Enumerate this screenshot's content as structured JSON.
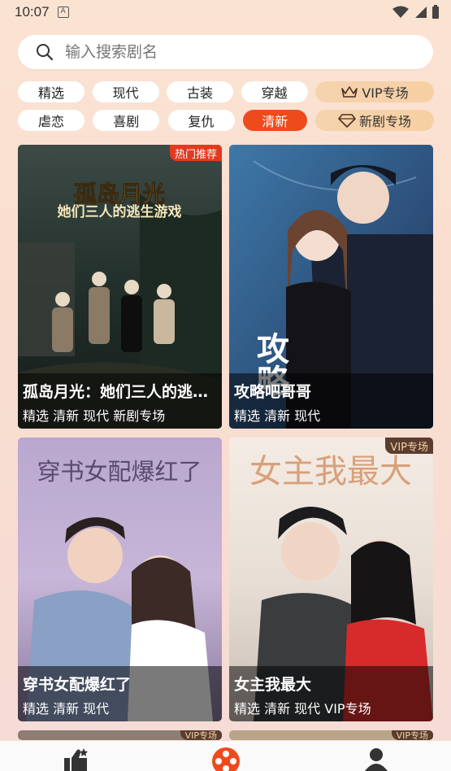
{
  "status": {
    "time": "10:07"
  },
  "search": {
    "placeholder": "输入搜索剧名"
  },
  "chips": [
    {
      "label": "精选"
    },
    {
      "label": "现代"
    },
    {
      "label": "古装"
    },
    {
      "label": "穿越"
    },
    {
      "label": "VIP专场"
    },
    {
      "label": "虐恋"
    },
    {
      "label": "喜剧"
    },
    {
      "label": "复仇"
    },
    {
      "label": "清新"
    },
    {
      "label": "新剧专场"
    }
  ],
  "cards": [
    {
      "title": "孤岛月光：她们三人的逃生游戏",
      "tags": "精选 清新 现代 新剧专场",
      "badge": "热门推荐",
      "poster_title": "孤岛月光",
      "poster_subtitle": "她们三人的逃生游戏"
    },
    {
      "title": "攻略吧哥哥",
      "tags": "精选 清新 现代",
      "poster_title": "攻略"
    },
    {
      "title": "穿书女配爆红了",
      "tags": "精选 清新 现代",
      "poster_title": "穿书女配爆红了"
    },
    {
      "title": "女主我最大",
      "tags": "精选 清新 现代 VIP专场",
      "badge": "VIP专场",
      "poster_title": "女主我最大"
    }
  ],
  "peek_badges": [
    "VIP专场",
    "VIP专场"
  ],
  "colors": {
    "accent": "#ee4a1c",
    "vip_badge": "#5b3d2e"
  },
  "nav": [
    "thumb-up-icon",
    "film-reel-icon",
    "user-icon"
  ]
}
